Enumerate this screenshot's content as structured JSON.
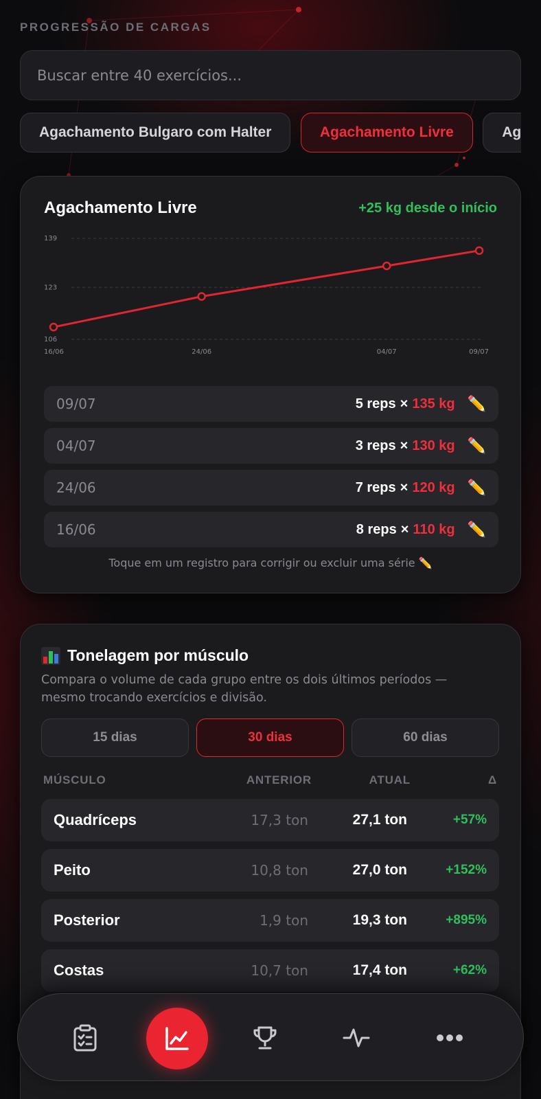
{
  "header": {
    "section_label": "PROGRESSÃO DE CARGAS"
  },
  "search": {
    "placeholder": "Buscar entre 40 exercícios..."
  },
  "exercise_chips": [
    {
      "label": "Agachamento Bulgaro com Halter",
      "active": false
    },
    {
      "label": "Agachamento Livre",
      "active": true
    },
    {
      "label": "Agachamento",
      "active": false
    }
  ],
  "progress_card": {
    "title": "Agachamento Livre",
    "gain": "+25 kg desde o início",
    "hint": "Toque em um registro para corrigir ou excluir uma série ✏️",
    "records": [
      {
        "date": "09/07",
        "reps": "5 reps",
        "weight": "135 kg"
      },
      {
        "date": "04/07",
        "reps": "3 reps",
        "weight": "130 kg"
      },
      {
        "date": "24/06",
        "reps": "7 reps",
        "weight": "120 kg"
      },
      {
        "date": "16/06",
        "reps": "8 reps",
        "weight": "110 kg"
      }
    ],
    "times_symbol": "×",
    "edit_icon": "✏️"
  },
  "chart_data": {
    "type": "line",
    "x": [
      "16/06",
      "24/06",
      "04/07",
      "09/07"
    ],
    "series": [
      {
        "values": [
          110,
          120,
          130,
          135
        ],
        "color": "#e0262f"
      }
    ],
    "y_ticks": [
      106,
      123,
      139
    ],
    "ylim": [
      106,
      139
    ],
    "grid": true,
    "title": "",
    "xlabel": "",
    "ylabel": ""
  },
  "tonnage_card": {
    "title": "Tonelagem por músculo",
    "icon": "bar-chart-icon",
    "description": "Compara o volume de cada grupo entre os dois últimos períodos — mesmo trocando exercícios e divisão.",
    "periods": [
      {
        "label": "15 dias",
        "active": false
      },
      {
        "label": "30 dias",
        "active": true
      },
      {
        "label": "60 dias",
        "active": false
      }
    ],
    "columns": {
      "muscle": "MÚSCULO",
      "previous": "ANTERIOR",
      "current": "ATUAL",
      "delta": "Δ"
    },
    "rows": [
      {
        "muscle": "Quadríceps",
        "previous": "17,3 ton",
        "current": "27,1 ton",
        "delta": "+57%"
      },
      {
        "muscle": "Peito",
        "previous": "10,8 ton",
        "current": "27,0 ton",
        "delta": "+152%"
      },
      {
        "muscle": "Posterior",
        "previous": "1,9 ton",
        "current": "19,3 ton",
        "delta": "+895%"
      },
      {
        "muscle": "Costas",
        "previous": "10,7 ton",
        "current": "17,4 ton",
        "delta": "+62%"
      }
    ]
  },
  "bottom_nav": [
    {
      "icon": "clipboard-checklist-icon",
      "active": false
    },
    {
      "icon": "chart-line-icon",
      "active": true
    },
    {
      "icon": "trophy-icon",
      "active": false
    },
    {
      "icon": "activity-pulse-icon",
      "active": false
    },
    {
      "icon": "more-dots-icon",
      "active": false
    }
  ],
  "colors": {
    "accent": "#e0262f",
    "positive": "#2fc05c",
    "background": "#0c0c0e",
    "card": "#1b1b1e"
  }
}
